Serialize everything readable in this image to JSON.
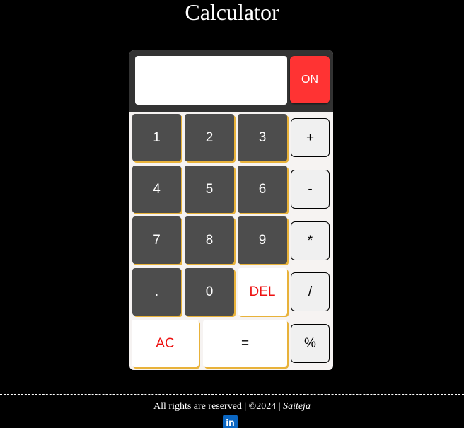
{
  "page": {
    "title": "Calculator"
  },
  "calculator": {
    "display_value": "",
    "on_label": "ON",
    "keys": {
      "k1": "1",
      "k2": "2",
      "k3": "3",
      "k4": "4",
      "k5": "5",
      "k6": "6",
      "k7": "7",
      "k8": "8",
      "k9": "9",
      "dot": ".",
      "k0": "0",
      "del": "DEL",
      "ac": "AC",
      "equals": "=",
      "plus": "+",
      "minus": "-",
      "multiply": "*",
      "divide": "/",
      "percent": "%"
    }
  },
  "footer": {
    "rights_text": "All rights are reserved | ©2024 |",
    "author": "Saiteja",
    "linkedin_icon_text": "in"
  },
  "colors": {
    "background": "#000000",
    "on_button": "#ff3333",
    "digit_key": "#4d4d4d",
    "key_shadow": "#e8b23a",
    "danger_text": "#ee1111",
    "operator_key": "#f0f0f0",
    "linkedin": "#0a66c2"
  }
}
